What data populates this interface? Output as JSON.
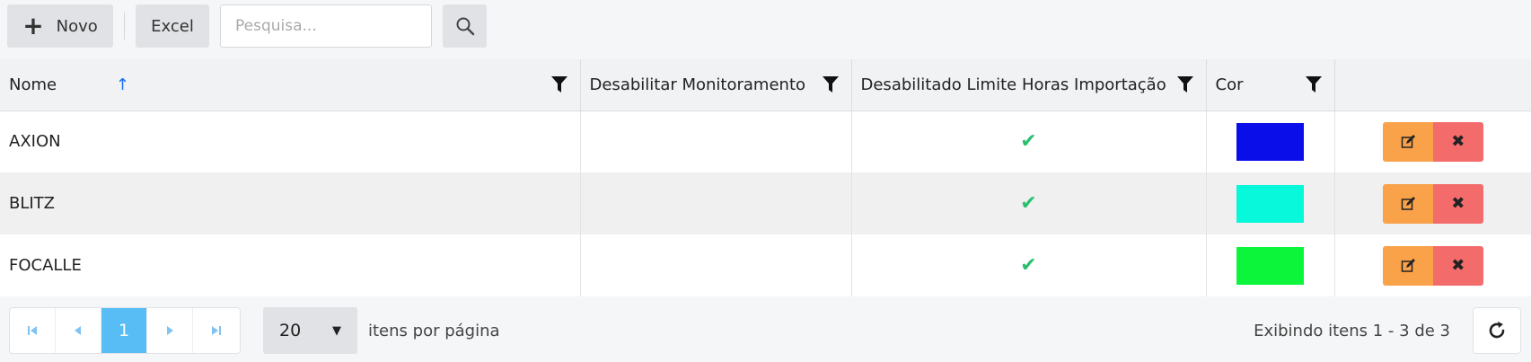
{
  "toolbar": {
    "new_label": "Novo",
    "excel_label": "Excel",
    "search_placeholder": "Pesquisa...",
    "search_value": ""
  },
  "grid": {
    "columns": [
      {
        "label": "Nome",
        "sorted": "ascending"
      },
      {
        "label": "Desabilitar Monitoramento"
      },
      {
        "label": "Desabilitado Limite Horas Importação"
      },
      {
        "label": "Cor"
      },
      {
        "label": ""
      }
    ],
    "rows": [
      {
        "nome": "AXION",
        "desabilitar_monitoramento": false,
        "desabilitado_limite": true,
        "cor": "#0a0ee8"
      },
      {
        "nome": "BLITZ",
        "desabilitar_monitoramento": false,
        "desabilitado_limite": true,
        "cor": "#08f8dc"
      },
      {
        "nome": "FOCALLE",
        "desabilitar_monitoramento": false,
        "desabilitado_limite": true,
        "cor": "#0cf53a"
      }
    ]
  },
  "pager": {
    "current_page": "1",
    "page_size": "20",
    "per_page_label": "itens por página",
    "info": "Exibindo itens 1 - 3 de 3"
  },
  "icons": {
    "new": "plus-icon",
    "search": "search-icon",
    "filter": "filter-icon",
    "sort": "arrow-up-icon",
    "check": "check-icon",
    "edit": "edit-icon",
    "delete": "close-icon",
    "refresh": "refresh-icon"
  },
  "colors": {
    "accent": "#58bdf4",
    "check": "#2bbf6e",
    "edit_button": "#f9a24a",
    "delete_button": "#f46b6b",
    "sort_arrow": "#1a6ef5"
  }
}
